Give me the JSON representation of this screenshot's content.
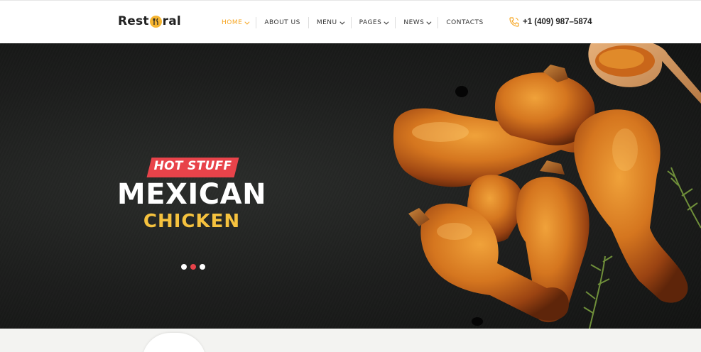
{
  "brand": {
    "name_left": "Rest",
    "name_right": "ral"
  },
  "nav": {
    "items": [
      {
        "label": "HOME",
        "has_dropdown": true,
        "active": true
      },
      {
        "label": "ABOUT US",
        "has_dropdown": false,
        "active": false
      },
      {
        "label": "MENU",
        "has_dropdown": true,
        "active": false
      },
      {
        "label": "PAGES",
        "has_dropdown": true,
        "active": false
      },
      {
        "label": "NEWS",
        "has_dropdown": true,
        "active": false
      },
      {
        "label": "CONTACTS",
        "has_dropdown": false,
        "active": false
      }
    ]
  },
  "contact": {
    "phone": "+1 (409) 987–5874",
    "icon": "phone-icon"
  },
  "hero": {
    "badge": "HOT STUFF",
    "title": "MEXICAN",
    "subtitle": "CHICKEN",
    "slider": {
      "slides": 3,
      "active_index": 1
    }
  },
  "colors": {
    "accent": "#f6a623",
    "badge": "#e8434a",
    "highlight": "#f6c23e",
    "hero_bg": "#1c1d1c"
  }
}
